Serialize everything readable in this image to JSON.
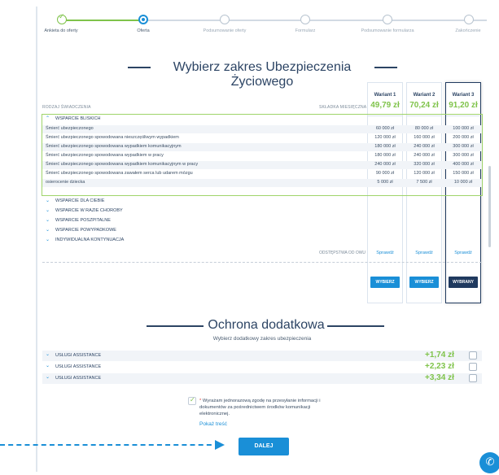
{
  "stepper": {
    "steps": [
      {
        "label": "Ankieta do oferty",
        "state": "done"
      },
      {
        "label": "Oferta",
        "state": "active"
      },
      {
        "label": "Podsumowanie oferty",
        "state": "pending"
      },
      {
        "label": "Formularz",
        "state": "pending"
      },
      {
        "label": "Podsumowanie formularza",
        "state": "pending"
      },
      {
        "label": "Zakończenie",
        "state": "pending"
      }
    ]
  },
  "main": {
    "title": "Wybierz zakres Ubezpieczenia Życiowego",
    "col_benefit": "RODZAJ ŚWIADCZENIA",
    "col_premium": "SKŁADKA MIESIĘCZNA",
    "variants": [
      {
        "name": "Wariant 1",
        "price": "49,79 zł",
        "check": "Sprawdź",
        "button": "WYBIERZ",
        "selected": false
      },
      {
        "name": "Wariant 2",
        "price": "70,24 zł",
        "check": "Sprawdź",
        "button": "WYBIERZ",
        "selected": false
      },
      {
        "name": "Wariant 3",
        "price": "91,20 zł",
        "check": "Sprawdź",
        "button": "WYBRANY",
        "selected": true
      }
    ],
    "open_group": "WSPARCIE BLISKICH",
    "rows": [
      {
        "label": "Śmierć ubezpieczonego",
        "v1": "60 000 zł",
        "v2": "80 000 zł",
        "v3": "100 000 zł"
      },
      {
        "label": "Śmierć ubezpieczonego spowodowana nieszczęśliwym wypadkiem",
        "v1": "120 000 zł",
        "v2": "160 000 zł",
        "v3": "200 000 zł"
      },
      {
        "label": "Śmierć ubezpieczonego spowodowana wypadkiem komunikacyjnym",
        "v1": "180 000 zł",
        "v2": "240 000 zł",
        "v3": "300 000 zł"
      },
      {
        "label": "Śmierć ubezpieczonego spowodowana wypadkiem w pracy",
        "v1": "180 000 zł",
        "v2": "240 000 zł",
        "v3": "300 000 zł"
      },
      {
        "label": "Śmierć ubezpieczonego spowodowana wypadkiem komunikacyjnym w pracy",
        "v1": "240 000 zł",
        "v2": "320 000 zł",
        "v3": "400 000 zł"
      },
      {
        "label": "Śmierć ubezpieczonego spowodowana zawałem serca lub udarem mózgu",
        "v1": "90 000 zł",
        "v2": "120 000 zł",
        "v3": "150 000 zł"
      },
      {
        "label": "osierocenie dziecka",
        "v1": "5 000 zł",
        "v2": "7 500 zł",
        "v3": "10 000 zł"
      }
    ],
    "collapsed_groups": [
      "WSPARCIE DLA CIEBIE",
      "WSPARCIE W RAZIE CHOROBY",
      "WSPARCIE POSZPITALNE",
      "WSPARCIE POWYPADKOWE",
      "INDYWIDUALNA KONTYNUACJA"
    ],
    "exclusions_label": "ODSTĘPSTWA OD OWU"
  },
  "addons": {
    "title": "Ochrona dodatkowa",
    "subtitle": "Wybierz dodatkowy zakres ubezpieczenia",
    "items": [
      {
        "label": "USŁUGI ASSISTANCE",
        "price": "+1,74 zł"
      },
      {
        "label": "USŁUGI ASSISTANCE",
        "price": "+2,23 zł"
      },
      {
        "label": "USŁUGI ASSISTANCE",
        "price": "+3,34 zł"
      }
    ]
  },
  "consent": {
    "required_mark": "*",
    "text": "Wyrażam jednorazową zgodę na przesyłanie informacji i dokumentów za pośrednictwem środków komunikacji elektronicznej.",
    "show_more": "Pokaż treść"
  },
  "footer": {
    "next_label": "DALEJ"
  },
  "icons": {
    "phone": "phone-icon",
    "chevron_up": "chevron-up-icon",
    "chevron_down": "chevron-down-icon",
    "check": "check-icon"
  },
  "colors": {
    "accent": "#1a8fd7",
    "navy": "#203a5f",
    "green": "#7fc34a"
  }
}
